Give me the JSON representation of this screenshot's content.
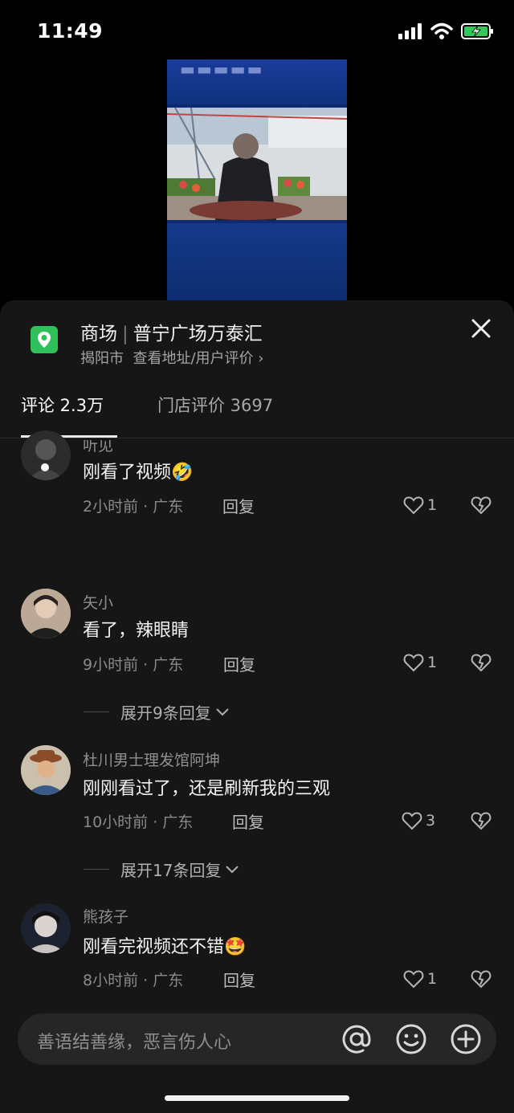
{
  "status": {
    "time": "11:49"
  },
  "poi": {
    "category": "商场",
    "name": "普宁广场万泰汇",
    "city": "揭阳市",
    "link": "查看地址/用户评价 ›",
    "icon": "location-pin-icon",
    "accent_color": "#2fc05a"
  },
  "tabs": [
    {
      "label": "评论 2.3万",
      "active": true
    },
    {
      "label": "门店评价 3697",
      "active": false
    }
  ],
  "comments": [
    {
      "name": "听见",
      "text": "刚看了视频🤣",
      "time": "2小时前 · 广东",
      "reply": "回复",
      "likes": "1"
    },
    {
      "name": "矢小",
      "text": "看了，辣眼睛",
      "time": "9小时前 · 广东",
      "reply": "回复",
      "likes": "1",
      "expand": "展开9条回复"
    },
    {
      "name": "杜川男士理发馆阿坤",
      "text": "刚刚看过了，还是刷新我的三观",
      "time": "10小时前 · 广东",
      "reply": "回复",
      "likes": "3",
      "expand": "展开17条回复"
    },
    {
      "name": "熊孩子",
      "text": "刚看完视频还不错🤩",
      "time": "8小时前 · 广东",
      "reply": "回复",
      "likes": "1"
    }
  ],
  "input": {
    "placeholder": "善语结善缘，恶言伤人心",
    "icons": [
      "at-icon",
      "emoji-icon",
      "add-icon"
    ]
  }
}
